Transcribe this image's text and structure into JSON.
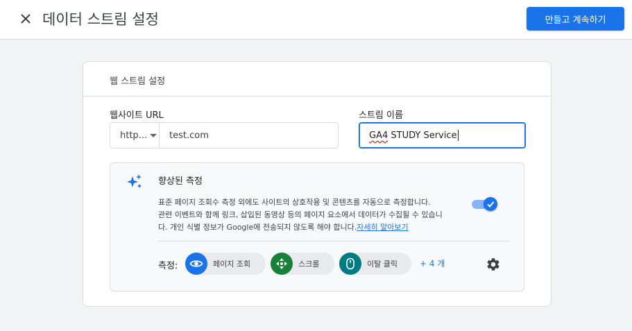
{
  "header": {
    "title": "데이터 스트림 설정",
    "primary_button": "만들고 계속하기",
    "close_icon": "close-icon"
  },
  "card": {
    "title": "웹 스트림 설정",
    "website_url_label": "웹사이트 URL",
    "protocol": "http...",
    "url_value": "test.com",
    "stream_name_label": "스트림 이름",
    "stream_name_value_prefix": "GA4",
    "stream_name_value_rest": " STUDY Service"
  },
  "enhanced": {
    "title": "향상된 측정",
    "desc_line1": "표준 페이지 조회수 측정 외에도 사이트의 상호작용 및 콘텐츠를 자동으로 측정합니다.",
    "desc_line2": "관련 이벤트와 함께 링크, 삽입된 동영상 등의 페이지 요소에서 데이터가 수집될 수 있습니",
    "desc_line3": "다. 개인 식별 정보가 Google에 전송되지 않도록 해야 합니다.",
    "learn_more": "자세히 알아보기",
    "toggle_on": true,
    "measure_label": "측정:",
    "chips": [
      {
        "label": "페이지 조회",
        "icon": "eye-icon",
        "color": "#1a73e8"
      },
      {
        "label": "스크롤",
        "icon": "compass-arrows-icon",
        "color": "#188038"
      },
      {
        "label": "이탈 클릭",
        "icon": "mouse-icon",
        "color": "#007b83"
      }
    ],
    "more": "+ 4 개",
    "settings_icon": "gear-icon"
  },
  "colors": {
    "accent": "#1a73e8",
    "background": "#f1f3f4"
  }
}
